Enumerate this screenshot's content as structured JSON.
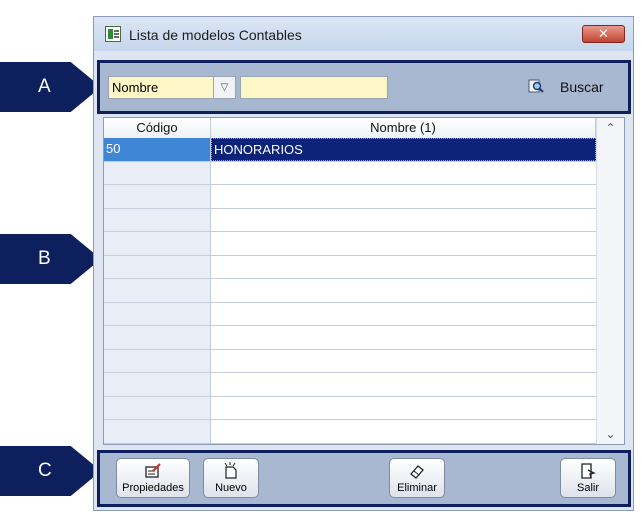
{
  "window": {
    "title": "Lista de modelos Contables",
    "close_glyph": "✕"
  },
  "markers": {
    "a": "A",
    "b": "B",
    "c": "C"
  },
  "search": {
    "field_value": "Nombre",
    "input_value": "",
    "button_label": "Buscar",
    "field_icon": "chevron-down-icon",
    "button_icon": "search-icon"
  },
  "grid": {
    "columns": [
      "Código",
      "Nombre (1)"
    ],
    "rows": [
      {
        "code": "50",
        "name": "HONORARIOS",
        "selected": true
      }
    ]
  },
  "toolbar": {
    "properties_label": "Propiedades",
    "new_label": "Nuevo",
    "delete_label": "Eliminar",
    "exit_label": "Salir"
  },
  "colors": {
    "marker": "#0d1f5c",
    "panel": "#a8b8d0",
    "input_bg": "#fef6c7",
    "selection": "#0c2379",
    "close_button": "#c5432f"
  }
}
